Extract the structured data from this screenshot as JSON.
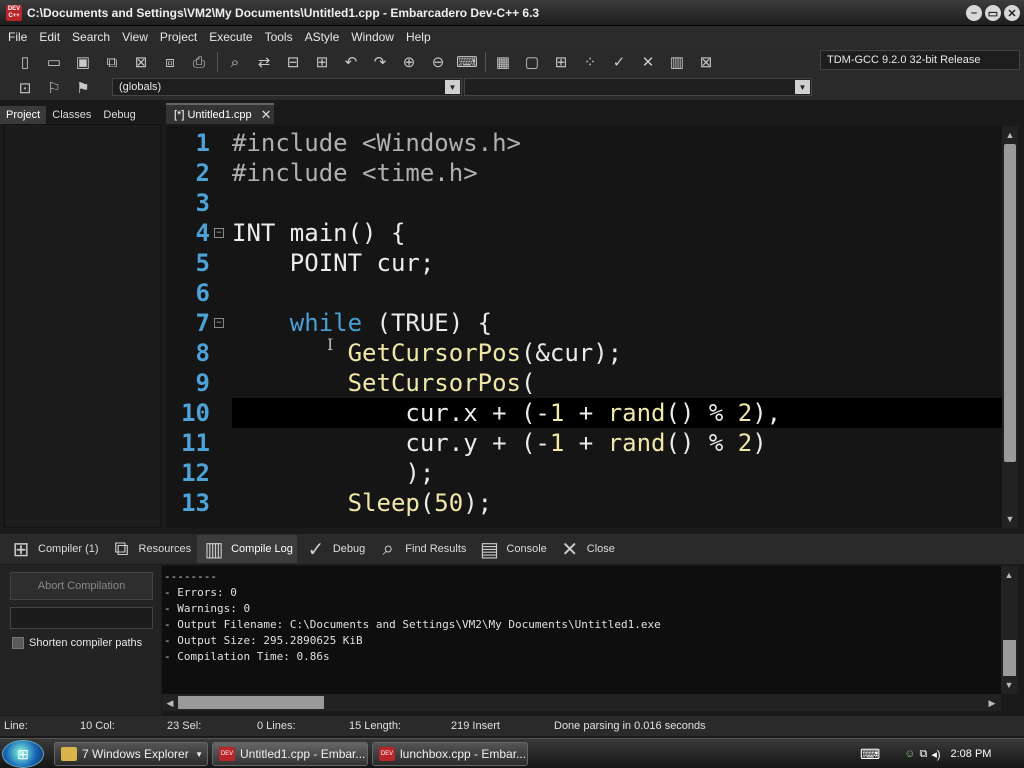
{
  "window": {
    "title": "C:\\Documents and Settings\\VM2\\My Documents\\Untitled1.cpp - Embarcadero Dev-C++ 6.3",
    "logo_text": "DEV C++",
    "minimize": "–",
    "restore": "▭",
    "close": "✕"
  },
  "menu": [
    "File",
    "Edit",
    "Search",
    "View",
    "Project",
    "Execute",
    "Tools",
    "AStyle",
    "Window",
    "Help"
  ],
  "toolbar": {
    "compiler": "TDM-GCC 9.2.0 32-bit Release",
    "globals": "(globals)"
  },
  "left_tabs": [
    "Project",
    "Classes",
    "Debug"
  ],
  "editor_tab": {
    "label": "[*] Untitled1.cpp",
    "close": "✕"
  },
  "code": {
    "line_numbers": [
      "1",
      "2",
      "3",
      "4",
      "5",
      "6",
      "7",
      "8",
      "9",
      "10",
      "11",
      "12",
      "13"
    ],
    "current_line": 10
  },
  "bottom_tabs": [
    "Compiler (1)",
    "Resources",
    "Compile Log",
    "Debug",
    "Find Results",
    "Console",
    "Close"
  ],
  "compile_panel": {
    "abort_label": "Abort Compilation",
    "shorten_label": "Shorten compiler paths",
    "shorten_checked": false
  },
  "log_lines": [
    "--------",
    "- Errors: 0",
    "- Warnings: 0",
    "- Output Filename: C:\\Documents and Settings\\VM2\\My Documents\\Untitled1.exe",
    "- Output Size: 295.2890625 KiB",
    "- Compilation Time: 0.86s"
  ],
  "status": {
    "line_label": "Line:",
    "col": "10 Col:",
    "sel": "23 Sel:",
    "lines": "0 Lines:",
    "length": "15 Length:",
    "insert": "219 Insert",
    "message": "Done parsing in 0.016 seconds"
  },
  "taskbar": {
    "explorer": "7 Windows Explorer",
    "task1": "Untitled1.cpp - Embar...",
    "task2": "lunchbox.cpp - Embar...",
    "clock": "2:08 PM"
  },
  "colors": {
    "line_numbers": "#4da3d8",
    "keyword": "#4a9fd8",
    "function": "#f0e8a8",
    "preprocessor": "#b0b0b0"
  }
}
